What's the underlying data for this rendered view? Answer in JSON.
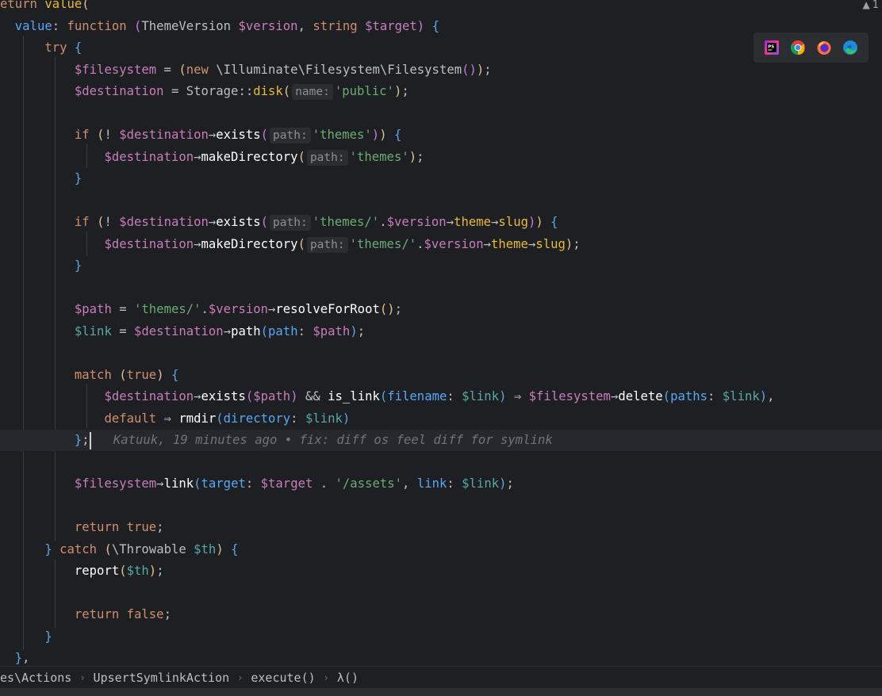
{
  "status": {
    "warning_count": "1"
  },
  "editor": {
    "lines": [
      [
        [
          "t-kw",
          "eturn "
        ],
        [
          "t-fn",
          "value"
        ],
        [
          "t-p1",
          "("
        ]
      ],
      [
        [
          "t-plain",
          "  "
        ],
        [
          "t-named",
          "value"
        ],
        [
          "t-plain",
          ": "
        ],
        [
          "t-kw",
          "function "
        ],
        [
          "t-p2",
          "("
        ],
        [
          "t-plain",
          "ThemeVersion "
        ],
        [
          "t-var",
          "$version"
        ],
        [
          "t-plain",
          ", "
        ],
        [
          "t-kw",
          "string "
        ],
        [
          "t-var",
          "$target"
        ],
        [
          "t-p2",
          ")"
        ],
        [
          "t-plain",
          " "
        ],
        [
          "t-brc",
          "{"
        ]
      ],
      [
        [
          "t-plain",
          "      "
        ],
        [
          "t-kw",
          "try "
        ],
        [
          "t-brc",
          "{"
        ]
      ],
      [
        [
          "t-plain",
          "          "
        ],
        [
          "t-var",
          "$filesystem"
        ],
        [
          "t-plain",
          " = "
        ],
        [
          "t-p1",
          "("
        ],
        [
          "t-kw",
          "new "
        ],
        [
          "t-plain",
          "\\Illuminate\\Filesystem\\Filesystem"
        ],
        [
          "t-p2",
          "()"
        ],
        [
          "t-p1",
          ")"
        ],
        [
          "t-plain",
          ";"
        ]
      ],
      [
        [
          "t-plain",
          "          "
        ],
        [
          "t-var",
          "$destination"
        ],
        [
          "t-plain",
          " = Storage"
        ],
        [
          "t-plain",
          "::"
        ],
        [
          "t-fn",
          "disk"
        ],
        [
          "t-p1",
          "("
        ],
        [
          "hint",
          "name:"
        ],
        [
          "t-str",
          "'public'"
        ],
        [
          "t-p1",
          ")"
        ],
        [
          "t-plain",
          ";"
        ]
      ],
      [],
      [
        [
          "t-plain",
          "          "
        ],
        [
          "t-kw",
          "if "
        ],
        [
          "t-p1",
          "("
        ],
        [
          "t-plain",
          "! "
        ],
        [
          "t-var",
          "$destination"
        ],
        [
          "t-plain",
          "→"
        ],
        [
          "t-mtd",
          "exists"
        ],
        [
          "t-p2",
          "("
        ],
        [
          "hint",
          "path:"
        ],
        [
          "t-str",
          "'themes'"
        ],
        [
          "t-p2",
          ")"
        ],
        [
          "t-p1",
          ")"
        ],
        [
          "t-plain",
          " "
        ],
        [
          "t-brc",
          "{"
        ]
      ],
      [
        [
          "t-plain",
          "              "
        ],
        [
          "t-var",
          "$destination"
        ],
        [
          "t-plain",
          "→"
        ],
        [
          "t-mtd",
          "makeDirectory"
        ],
        [
          "t-p1",
          "("
        ],
        [
          "hint",
          "path:"
        ],
        [
          "t-str",
          "'themes'"
        ],
        [
          "t-p1",
          ")"
        ],
        [
          "t-plain",
          ";"
        ]
      ],
      [
        [
          "t-plain",
          "          "
        ],
        [
          "t-brc",
          "}"
        ]
      ],
      [],
      [
        [
          "t-plain",
          "          "
        ],
        [
          "t-kw",
          "if "
        ],
        [
          "t-p1",
          "("
        ],
        [
          "t-plain",
          "! "
        ],
        [
          "t-var",
          "$destination"
        ],
        [
          "t-plain",
          "→"
        ],
        [
          "t-mtd",
          "exists"
        ],
        [
          "t-p2",
          "("
        ],
        [
          "hint",
          "path:"
        ],
        [
          "t-str",
          "'themes/'"
        ],
        [
          "t-plain",
          "."
        ],
        [
          "t-var",
          "$version"
        ],
        [
          "t-plain",
          "→"
        ],
        [
          "t-fn",
          "theme"
        ],
        [
          "t-plain",
          "→"
        ],
        [
          "t-fn",
          "slug"
        ],
        [
          "t-p2",
          ")"
        ],
        [
          "t-p1",
          ")"
        ],
        [
          "t-plain",
          " "
        ],
        [
          "t-brc",
          "{"
        ]
      ],
      [
        [
          "t-plain",
          "              "
        ],
        [
          "t-var",
          "$destination"
        ],
        [
          "t-plain",
          "→"
        ],
        [
          "t-mtd",
          "makeDirectory"
        ],
        [
          "t-p1",
          "("
        ],
        [
          "hint",
          "path:"
        ],
        [
          "t-str",
          "'themes/'"
        ],
        [
          "t-plain",
          "."
        ],
        [
          "t-var",
          "$version"
        ],
        [
          "t-plain",
          "→"
        ],
        [
          "t-fn",
          "theme"
        ],
        [
          "t-plain",
          "→"
        ],
        [
          "t-fn",
          "slug"
        ],
        [
          "t-p1",
          ")"
        ],
        [
          "t-plain",
          ";"
        ]
      ],
      [
        [
          "t-plain",
          "          "
        ],
        [
          "t-brc",
          "}"
        ]
      ],
      [],
      [
        [
          "t-plain",
          "          "
        ],
        [
          "t-var",
          "$path"
        ],
        [
          "t-plain",
          " = "
        ],
        [
          "t-str",
          "'themes/'"
        ],
        [
          "t-plain",
          "."
        ],
        [
          "t-var",
          "$version"
        ],
        [
          "t-plain",
          "→"
        ],
        [
          "t-mtd",
          "resolveForRoot"
        ],
        [
          "t-p1",
          "()"
        ],
        [
          "t-plain",
          ";"
        ]
      ],
      [
        [
          "t-plain",
          "          "
        ],
        [
          "t-var2",
          "$link"
        ],
        [
          "t-plain",
          " = "
        ],
        [
          "t-var",
          "$destination"
        ],
        [
          "t-plain",
          "→"
        ],
        [
          "t-mtd",
          "path"
        ],
        [
          "t-p3",
          "("
        ],
        [
          "t-named",
          "path"
        ],
        [
          "t-plain",
          ": "
        ],
        [
          "t-var",
          "$path"
        ],
        [
          "t-p3",
          ")"
        ],
        [
          "t-plain",
          ";"
        ]
      ],
      [],
      [
        [
          "t-plain",
          "          "
        ],
        [
          "t-kw",
          "match "
        ],
        [
          "t-p1",
          "("
        ],
        [
          "t-kw",
          "true"
        ],
        [
          "t-p1",
          ")"
        ],
        [
          "t-plain",
          " "
        ],
        [
          "t-brc",
          "{"
        ]
      ],
      [
        [
          "t-plain",
          "              "
        ],
        [
          "t-var",
          "$destination"
        ],
        [
          "t-plain",
          "→"
        ],
        [
          "t-mtd",
          "exists"
        ],
        [
          "t-p2",
          "("
        ],
        [
          "t-var",
          "$path"
        ],
        [
          "t-p2",
          ")"
        ],
        [
          "t-plain",
          " && "
        ],
        [
          "t-mtd",
          "is_link"
        ],
        [
          "t-p3",
          "("
        ],
        [
          "t-named",
          "filename"
        ],
        [
          "t-plain",
          ": "
        ],
        [
          "t-var2",
          "$link"
        ],
        [
          "t-p3",
          ")"
        ],
        [
          "t-plain",
          " ⇒ "
        ],
        [
          "t-var",
          "$filesystem"
        ],
        [
          "t-plain",
          "→"
        ],
        [
          "t-mtd",
          "delete"
        ],
        [
          "t-p3",
          "("
        ],
        [
          "t-named",
          "paths"
        ],
        [
          "t-plain",
          ": "
        ],
        [
          "t-var2",
          "$link"
        ],
        [
          "t-p3",
          ")"
        ],
        [
          "t-plain",
          ","
        ]
      ],
      [
        [
          "t-plain",
          "              "
        ],
        [
          "t-kw",
          "default"
        ],
        [
          "t-plain",
          " ⇒ "
        ],
        [
          "t-mtd",
          "rmdir"
        ],
        [
          "t-p3",
          "("
        ],
        [
          "t-named",
          "directory"
        ],
        [
          "t-plain",
          ": "
        ],
        [
          "t-var2",
          "$link"
        ],
        [
          "t-p3",
          ")"
        ]
      ],
      [
        [
          "t-plain",
          "          "
        ],
        [
          "t-brc",
          "}"
        ],
        [
          "t-plain",
          ";"
        ],
        [
          "caret",
          ""
        ],
        [
          "t-blame",
          "   Katuuk, 19 minutes ago • fix: diff os feel diff for symlink"
        ]
      ],
      [],
      [
        [
          "t-plain",
          "          "
        ],
        [
          "t-var",
          "$filesystem"
        ],
        [
          "t-plain",
          "→"
        ],
        [
          "t-mtd",
          "link"
        ],
        [
          "t-p3",
          "("
        ],
        [
          "t-named",
          "target"
        ],
        [
          "t-plain",
          ": "
        ],
        [
          "t-var",
          "$target"
        ],
        [
          "t-plain",
          " . "
        ],
        [
          "t-str",
          "'/assets'"
        ],
        [
          "t-plain",
          ", "
        ],
        [
          "t-named",
          "link"
        ],
        [
          "t-plain",
          ": "
        ],
        [
          "t-var2",
          "$link"
        ],
        [
          "t-p3",
          ")"
        ],
        [
          "t-plain",
          ";"
        ]
      ],
      [],
      [
        [
          "t-plain",
          "          "
        ],
        [
          "t-kw",
          "return "
        ],
        [
          "t-kw",
          "true"
        ],
        [
          "t-plain",
          ";"
        ]
      ],
      [
        [
          "t-plain",
          "      "
        ],
        [
          "t-brc",
          "}"
        ],
        [
          "t-plain",
          " "
        ],
        [
          "t-kw",
          "catch "
        ],
        [
          "t-p1",
          "("
        ],
        [
          "t-plain",
          "\\Throwable "
        ],
        [
          "t-var2",
          "$th"
        ],
        [
          "t-p1",
          ")"
        ],
        [
          "t-plain",
          " "
        ],
        [
          "t-brc",
          "{"
        ]
      ],
      [
        [
          "t-plain",
          "          "
        ],
        [
          "t-mtd",
          "report"
        ],
        [
          "t-p1",
          "("
        ],
        [
          "t-var2",
          "$th"
        ],
        [
          "t-p1",
          ")"
        ],
        [
          "t-plain",
          ";"
        ]
      ],
      [],
      [
        [
          "t-plain",
          "          "
        ],
        [
          "t-kw",
          "return "
        ],
        [
          "t-kw",
          "false"
        ],
        [
          "t-plain",
          ";"
        ]
      ],
      [
        [
          "t-plain",
          "      "
        ],
        [
          "t-brc",
          "}"
        ]
      ],
      [
        [
          "t-plain",
          "  "
        ],
        [
          "t-brc",
          "}"
        ],
        [
          "t-plain",
          ","
        ]
      ]
    ],
    "current_line": 20
  },
  "browser_icons": [
    "phpstorm-icon",
    "chrome-icon",
    "firefox-icon",
    "edge-icon"
  ],
  "breadcrumb": [
    "es\\Actions",
    "UpsertSymlinkAction",
    "execute()",
    "λ()"
  ]
}
